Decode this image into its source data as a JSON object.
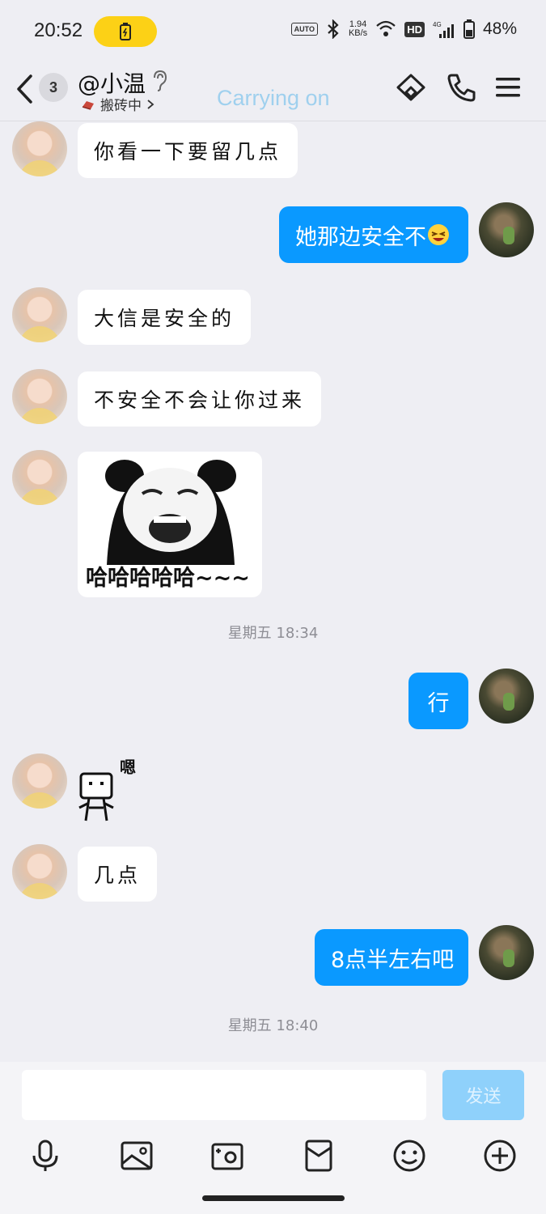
{
  "status_bar": {
    "time": "20:52",
    "net_speed_value": "1.94",
    "net_speed_unit": "KB/s",
    "auto_label": "AUTO",
    "hd_label": "HD",
    "net_type": "4G",
    "battery": "48%"
  },
  "header": {
    "unread_count": "3",
    "contact_name": "@小温",
    "contact_status": "搬砖中",
    "watermark": "Carrying on"
  },
  "messages": [
    {
      "from": "her",
      "type": "text",
      "text": "你看一下要留几点"
    },
    {
      "from": "me",
      "type": "text",
      "text": "她那边安全不"
    },
    {
      "from": "her",
      "type": "text",
      "text": "大信是安全的"
    },
    {
      "from": "her",
      "type": "text",
      "text": "不安全不会让你过来"
    },
    {
      "from": "her",
      "type": "sticker",
      "caption": "哈哈哈哈哈~~~"
    },
    {
      "type": "timestamp",
      "text": "星期五 18:34"
    },
    {
      "from": "me",
      "type": "text",
      "text": "行"
    },
    {
      "from": "her",
      "type": "sticker",
      "caption": "嗯"
    },
    {
      "from": "her",
      "type": "text",
      "text": "几点"
    },
    {
      "from": "me",
      "type": "text",
      "text": "8点半左右吧"
    },
    {
      "type": "timestamp",
      "text": "星期五 18:40"
    }
  ],
  "input": {
    "placeholder": "",
    "send_label": "发送"
  },
  "toolbar": [
    "microphone-icon",
    "image-icon",
    "camera-icon",
    "red-packet-icon",
    "emoji-icon",
    "plus-icon"
  ],
  "colors": {
    "background": "#eeeef3",
    "outgoing_bubble": "#0a99ff",
    "incoming_bubble": "#ffffff",
    "send_button": "#8fd1fb",
    "battery_pill": "#fcd116"
  }
}
